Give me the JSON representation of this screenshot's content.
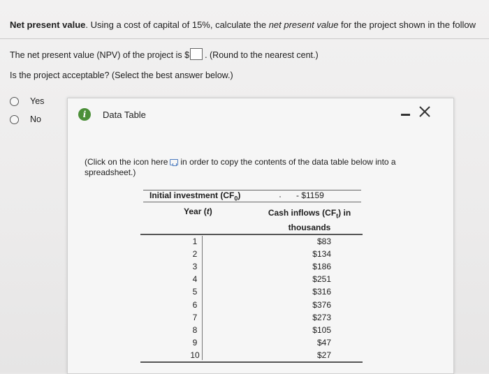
{
  "question": {
    "title": "Net present value",
    "text_part1": ". Using a cost of capital of 15%, calculate the ",
    "text_italic": "net present value",
    "text_part2": " for the project shown in the follow"
  },
  "npv": {
    "prefix": "The net present value (NPV) of the project is $",
    "answer_value": "",
    "suffix": ". (Round to the nearest cent.)"
  },
  "acceptance": {
    "prompt": "Is the project acceptable? (Select the best answer below.)",
    "options": [
      "Yes",
      "No"
    ]
  },
  "dialog": {
    "title": "Data Table",
    "info_icon_glyph": "i",
    "instruction_part1": "(Click on the icon here",
    "instruction_part2": "in order to copy the contents of the data table below into a spreadsheet.)",
    "table": {
      "header_initial": "Initial investment (CF",
      "header_initial_sub": "0",
      "header_initial_close": ")",
      "initial_value": "- $1159",
      "header_year": "Year (",
      "header_year_var": "t",
      "header_year_close": ")",
      "header_cf_line1": "Cash inflows (CF",
      "header_cf_sub": "t",
      "header_cf_line1_close": ") in",
      "header_cf_line2": "thousands",
      "rows": [
        {
          "year": "1",
          "cf": "$83"
        },
        {
          "year": "2",
          "cf": "$134"
        },
        {
          "year": "3",
          "cf": "$186"
        },
        {
          "year": "4",
          "cf": "$251"
        },
        {
          "year": "5",
          "cf": "$316"
        },
        {
          "year": "6",
          "cf": "$376"
        },
        {
          "year": "7",
          "cf": "$273"
        },
        {
          "year": "8",
          "cf": "$105"
        },
        {
          "year": "9",
          "cf": "$47"
        },
        {
          "year": "10",
          "cf": "$27"
        }
      ]
    }
  },
  "colors": {
    "info_icon": "#4b8f38",
    "copy_icon": "#4b7bbf"
  }
}
